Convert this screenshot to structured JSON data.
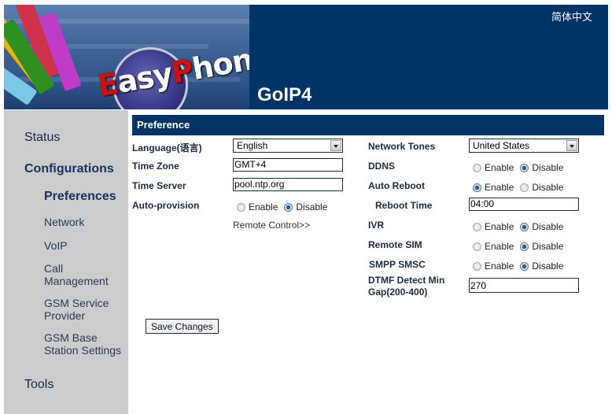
{
  "header": {
    "brand": "EasyPhone",
    "model": "GoIP4",
    "language_link": "简体中文"
  },
  "sidebar": {
    "status": "Status",
    "configurations": "Configurations",
    "sub_items": [
      {
        "label": "Preferences",
        "active": true
      },
      {
        "label": "Network"
      },
      {
        "label": "VoIP"
      },
      {
        "label": "Call Management"
      },
      {
        "label": "GSM Service Provider"
      },
      {
        "label": "GSM Base Station Settings"
      }
    ],
    "tools": "Tools"
  },
  "section": {
    "title": "Preference"
  },
  "form": {
    "language": {
      "label": "Language(语言)",
      "value": "English"
    },
    "time_zone": {
      "label": "Time Zone",
      "value": "GMT+4"
    },
    "time_server": {
      "label": "Time Server",
      "value": "pool.ntp.org"
    },
    "auto_provision": {
      "label": "Auto-provision",
      "enable": "Enable",
      "disable": "Disable",
      "selected": "Disable"
    },
    "remote_control_link": "Remote Control>>",
    "network_tones": {
      "label": "Network Tones",
      "value": "United States"
    },
    "ddns": {
      "label": "DDNS",
      "enable": "Enable",
      "disable": "Disable",
      "selected": "Disable"
    },
    "auto_reboot": {
      "label": "Auto Reboot",
      "enable": "Enable",
      "disable": "Disable",
      "selected": "Enable"
    },
    "reboot_time": {
      "label": "Reboot Time",
      "value": "04:00"
    },
    "ivr": {
      "label": "IVR",
      "enable": "Enable",
      "disable": "Disable",
      "selected": "Disable"
    },
    "remote_sim": {
      "label": "Remote SIM",
      "enable": "Enable",
      "disable": "Disable",
      "selected": "Disable"
    },
    "smpp_smsc": {
      "label": "SMPP SMSC",
      "enable": "Enable",
      "disable": "Disable",
      "selected": "Disable"
    },
    "dtmf_gap": {
      "label_line1": "DTMF Detect Min",
      "label_line2": "Gap(200-400)",
      "value": "270"
    },
    "save_button": "Save Changes"
  }
}
